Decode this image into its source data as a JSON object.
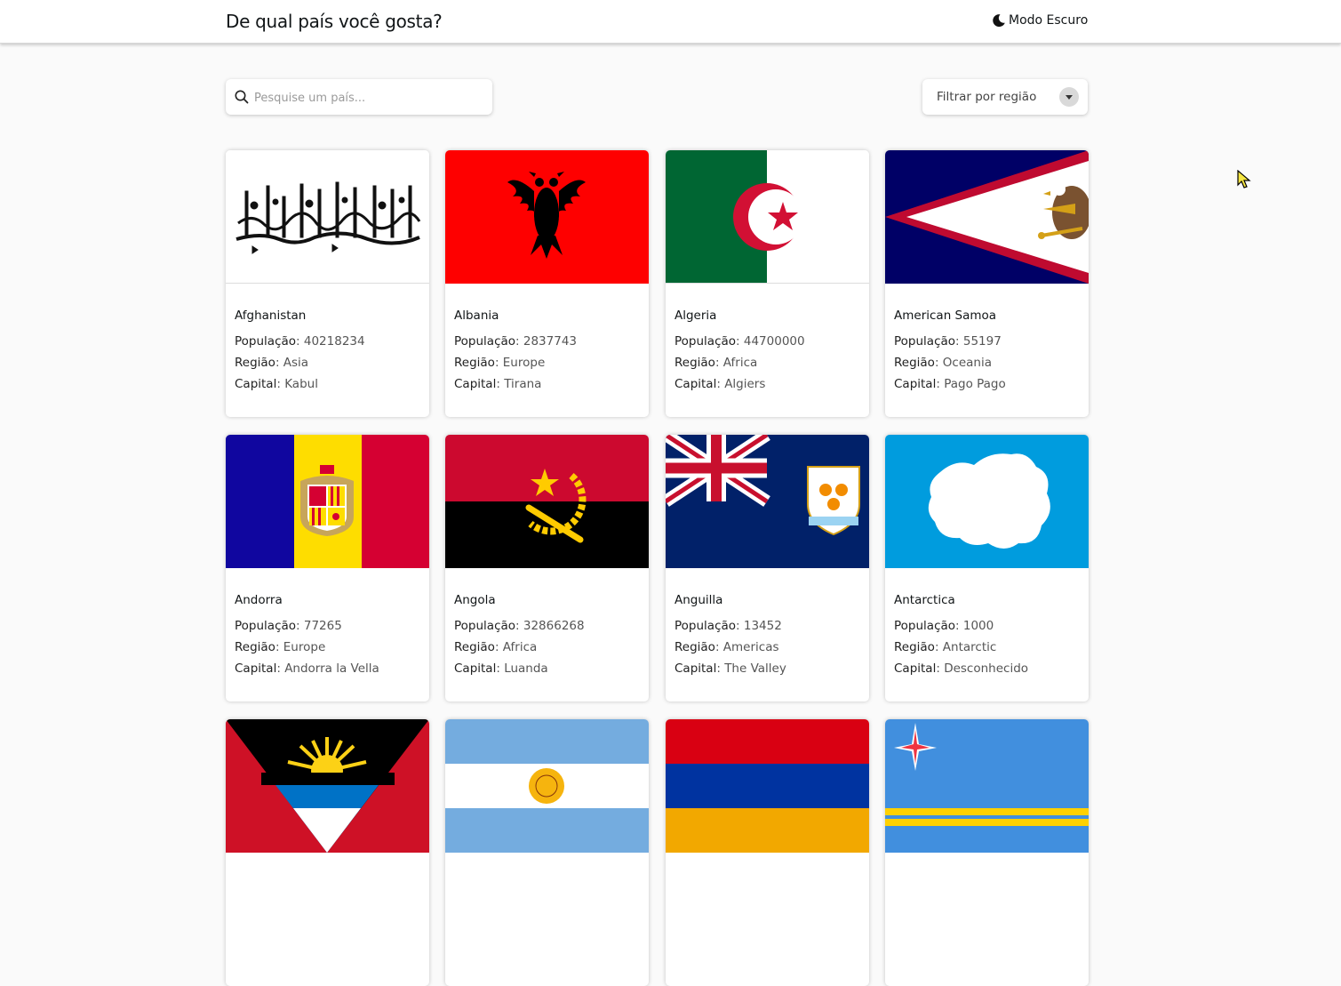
{
  "header": {
    "title": "De qual país você gosta?",
    "dark_mode_label": "Modo Escuro"
  },
  "search": {
    "placeholder": "Pesquise um país..."
  },
  "filter": {
    "label": "Filtrar por região"
  },
  "labels": {
    "population": "População",
    "region": "Região",
    "capital": "Capital"
  },
  "countries": [
    {
      "name": "Afghanistan",
      "population": "40218234",
      "region": "Asia",
      "capital": "Kabul",
      "flag": "afghanistan-flag"
    },
    {
      "name": "Albania",
      "population": "2837743",
      "region": "Europe",
      "capital": "Tirana",
      "flag": "albania-flag"
    },
    {
      "name": "Algeria",
      "population": "44700000",
      "region": "Africa",
      "capital": "Algiers",
      "flag": "algeria-flag"
    },
    {
      "name": "American Samoa",
      "population": "55197",
      "region": "Oceania",
      "capital": "Pago Pago",
      "flag": "american-samoa-flag"
    },
    {
      "name": "Andorra",
      "population": "77265",
      "region": "Europe",
      "capital": "Andorra la Vella",
      "flag": "andorra-flag"
    },
    {
      "name": "Angola",
      "population": "32866268",
      "region": "Africa",
      "capital": "Luanda",
      "flag": "angola-flag"
    },
    {
      "name": "Anguilla",
      "population": "13452",
      "region": "Americas",
      "capital": "The Valley",
      "flag": "anguilla-flag"
    },
    {
      "name": "Antarctica",
      "population": "1000",
      "region": "Antarctic",
      "capital": "Desconhecido",
      "flag": "antarctica-flag"
    },
    {
      "flag": "antigua-and-barbuda-flag"
    },
    {
      "flag": "argentina-flag"
    },
    {
      "flag": "armenia-flag"
    },
    {
      "flag": "aruba-flag"
    }
  ],
  "colors": {
    "background": "#fafafa",
    "card": "#ffffff",
    "text": "#111517"
  }
}
